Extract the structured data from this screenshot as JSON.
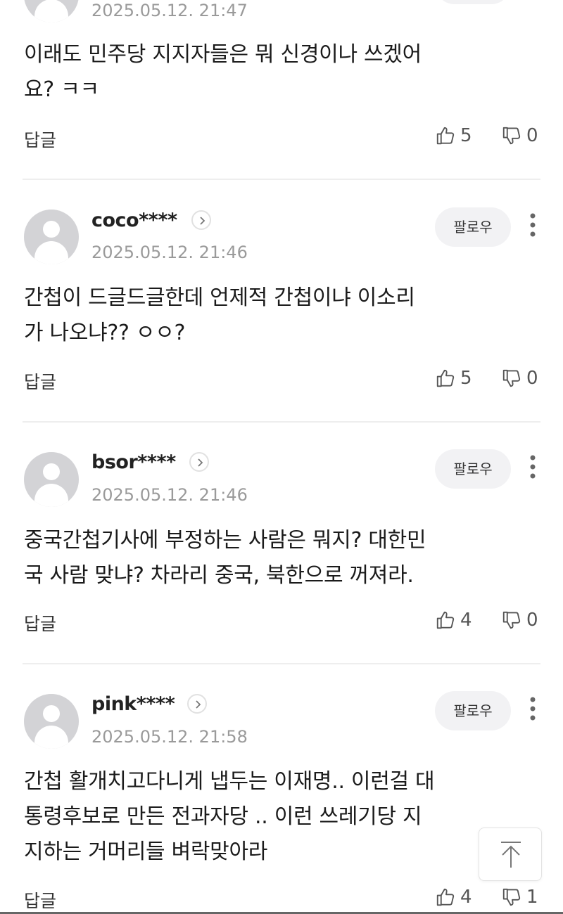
{
  "comments": [
    {
      "timestamp": "2025.05.12. 21:47",
      "text_lines": [
        "이래도 민주당 지지자들은 뭐 신경이나 쓰겠어",
        "요? ㅋㅋ"
      ],
      "reply_label": "답글",
      "likes": "5",
      "dislikes": "0"
    },
    {
      "username": "coco****",
      "timestamp": "2025.05.12. 21:46",
      "follow_label": "팔로우",
      "text_lines": [
        "간첩이 드글드글한데 언제적 간첩이냐 이소리",
        "가 나오냐?? ㅇㅇ?"
      ],
      "reply_label": "답글",
      "likes": "5",
      "dislikes": "0"
    },
    {
      "username": "bsor****",
      "timestamp": "2025.05.12. 21:46",
      "follow_label": "팔로우",
      "text_lines": [
        "중국간첩기사에 부정하는 사람은 뭐지? 대한민",
        "국 사람 맞냐? 차라리 중국, 북한으로 꺼져라."
      ],
      "reply_label": "답글",
      "likes": "4",
      "dislikes": "0"
    },
    {
      "username": "pink****",
      "timestamp": "2025.05.12. 21:58",
      "follow_label": "팔로우",
      "text_lines": [
        "간첩 활개치고다니게 냅두는 이재명.. 이런걸 대",
        "통령후보로 만든 전과자당 .. 이런 쓰레기당 지",
        "지하는 거머리들 벼락맞아라"
      ],
      "reply_label": "답글",
      "likes": "4",
      "dislikes": "1"
    }
  ],
  "icons": {
    "like": "thumbs-up-icon",
    "dislike": "thumbs-down-icon",
    "profile": "chevron-right-icon",
    "more": "more-vertical-icon",
    "scroll_top": "arrow-up-icon"
  },
  "colors": {
    "avatar_bg": "#d3d3d6",
    "follow_bg": "#f2f2f4",
    "timestamp": "#9a9a9a",
    "divider": "#eeeeee"
  }
}
